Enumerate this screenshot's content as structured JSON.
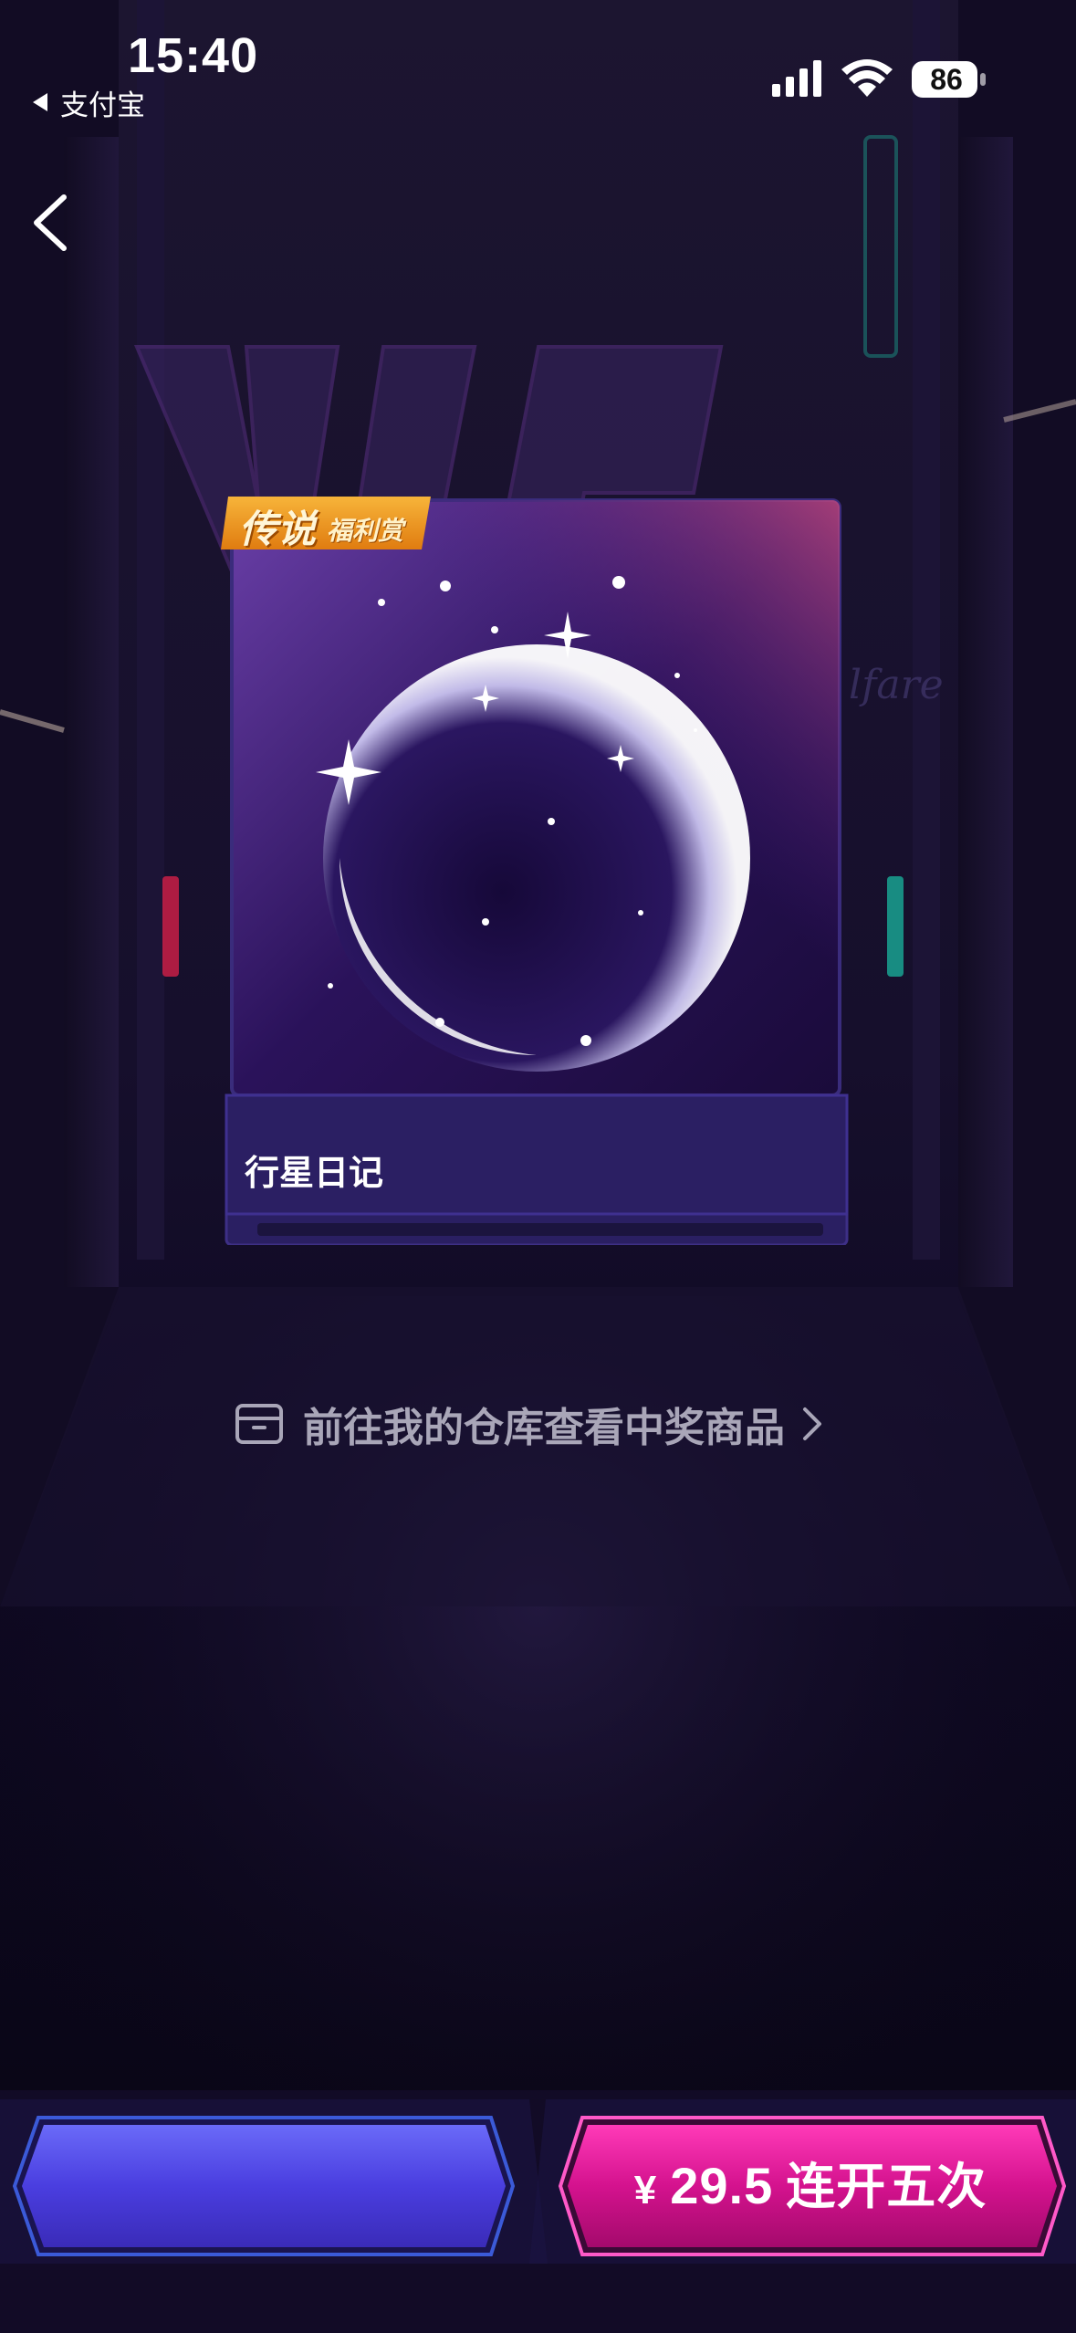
{
  "status_bar": {
    "time": "15:40",
    "back_app": "支付宝",
    "battery": "86"
  },
  "prize": {
    "badge_main": "传说",
    "badge_sub": "福利赏",
    "name": "行星日记"
  },
  "warehouse_link": {
    "label": "前往我的仓库查看中奖商品"
  },
  "buttons": {
    "left_label": "",
    "right_currency": "¥",
    "right_price": "29.5",
    "right_action": "连开五次"
  },
  "colors": {
    "accent_pink": "#d4128e",
    "accent_blue": "#4a3ee0",
    "badge_orange": "#f09a1c",
    "card_purple": "#2a1d63"
  },
  "icons": [
    "back-arrow-icon",
    "signal-icon",
    "wifi-icon",
    "battery-icon",
    "box-icon",
    "chevron-right-icon"
  ]
}
